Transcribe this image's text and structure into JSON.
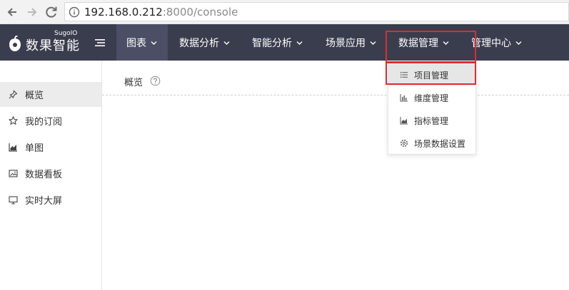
{
  "browser": {
    "url_host": "192.168.0.212",
    "url_rest": ":8000/console"
  },
  "brand": {
    "name": "数果智能",
    "sup": "SugoIO"
  },
  "topnav": {
    "items": [
      {
        "label": "图表"
      },
      {
        "label": "数据分析"
      },
      {
        "label": "智能分析"
      },
      {
        "label": "场景应用"
      },
      {
        "label": "数据管理"
      },
      {
        "label": "管理中心"
      }
    ]
  },
  "dropdown": {
    "items": [
      {
        "label": "项目管理",
        "icon": "list-icon"
      },
      {
        "label": "维度管理",
        "icon": "bar-chart-icon"
      },
      {
        "label": "指标管理",
        "icon": "area-chart-icon"
      },
      {
        "label": "场景数据设置",
        "icon": "gear-icon"
      }
    ]
  },
  "sidebar": {
    "items": [
      {
        "label": "概览",
        "icon": "pin-icon"
      },
      {
        "label": "我的订阅",
        "icon": "star-icon"
      },
      {
        "label": "单图",
        "icon": "area-chart-icon"
      },
      {
        "label": "数据看板",
        "icon": "image-board-icon"
      },
      {
        "label": "实时大屏",
        "icon": "monitor-icon"
      }
    ]
  },
  "main": {
    "title": "概览"
  },
  "colors": {
    "header_bg": "#3a3d4e",
    "highlight_red": "#e02c30"
  }
}
